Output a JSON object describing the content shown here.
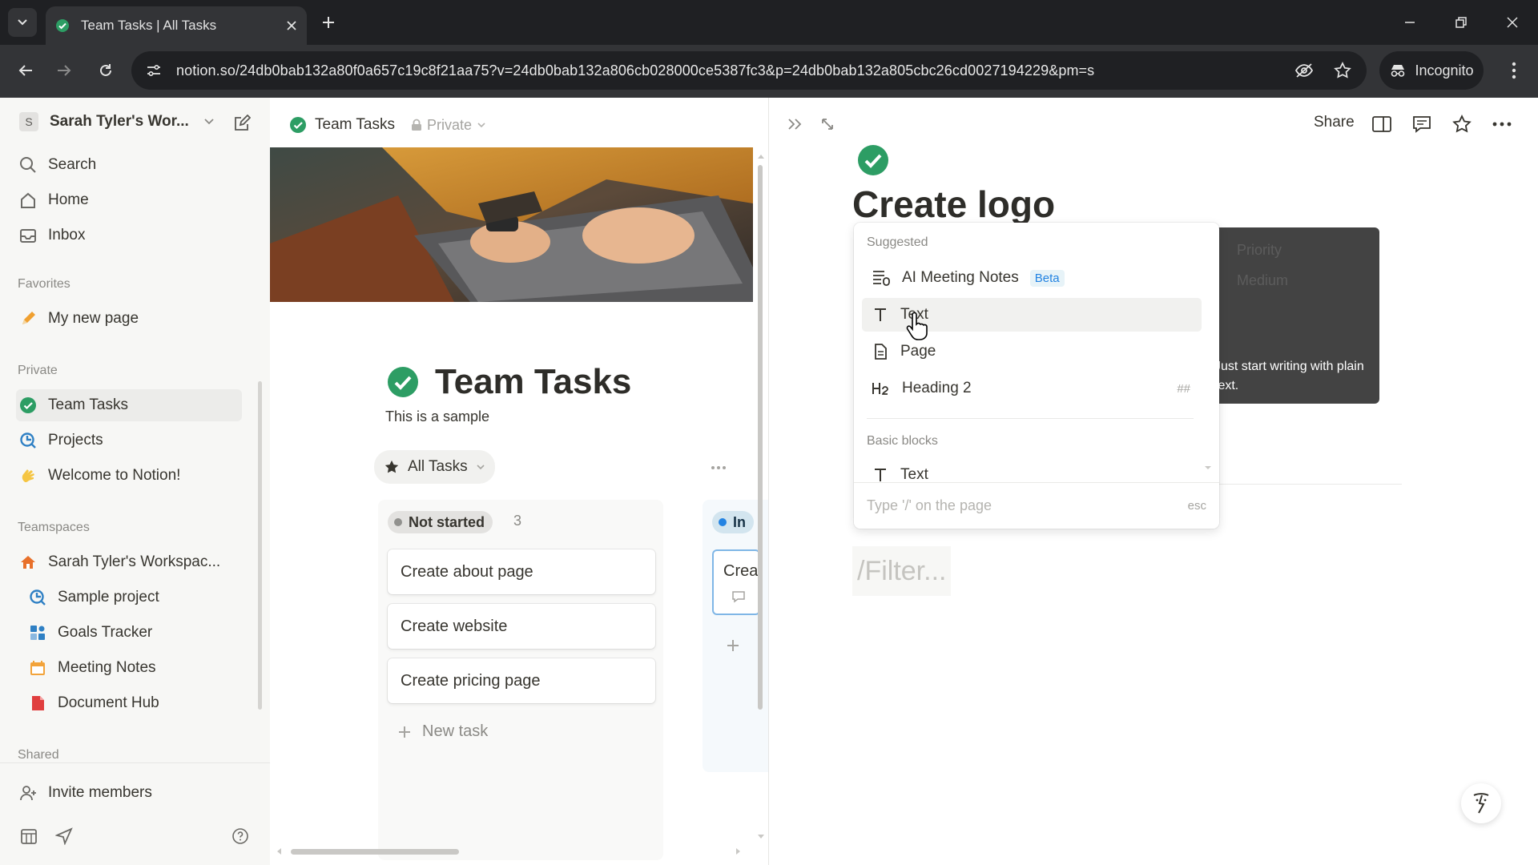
{
  "browser": {
    "tab_title": "Team Tasks | All Tasks",
    "url": "notion.so/24db0bab132a80f0a657c19c8f21aa75?v=24db0bab132a806cb028000ce5387fc3&p=24db0bab132a805cbc26cd0027194229&pm=s",
    "incognito_label": "Incognito"
  },
  "sidebar": {
    "workspace_initial": "S",
    "workspace_name": "Sarah Tyler's Wor...",
    "nav": [
      {
        "label": "Search",
        "icon": "search-icon"
      },
      {
        "label": "Home",
        "icon": "home-icon"
      },
      {
        "label": "Inbox",
        "icon": "inbox-icon"
      }
    ],
    "favorites_label": "Favorites",
    "favorites": [
      {
        "label": "My new page",
        "icon": "pencil-icon"
      }
    ],
    "private_label": "Private",
    "private": [
      {
        "label": "Team Tasks",
        "icon": "check-circle-icon"
      },
      {
        "label": "Projects",
        "icon": "projects-icon"
      },
      {
        "label": "Welcome to Notion!",
        "icon": "wave-icon"
      }
    ],
    "teamspaces_label": "Teamspaces",
    "teamspace_name": "Sarah Tyler's Workspac...",
    "teamspace_items": [
      {
        "label": "Sample project",
        "icon": "projects-icon"
      },
      {
        "label": "Goals Tracker",
        "icon": "goals-icon"
      },
      {
        "label": "Meeting Notes",
        "icon": "calendar-icon"
      },
      {
        "label": "Document Hub",
        "icon": "document-icon"
      }
    ],
    "shared_label": "Shared",
    "invite_label": "Invite members"
  },
  "middle": {
    "breadcrumb_title": "Team Tasks",
    "privacy_label": "Private",
    "page_title": "Team Tasks",
    "page_description": "This is a sample",
    "view_label": "All Tasks",
    "group_label": "Not started",
    "group_count": "3",
    "group2_label": "In",
    "cards": [
      "Create about page",
      "Create website",
      "Create pricing page"
    ],
    "partial_card": "Crea",
    "new_task_label": "New task"
  },
  "right": {
    "share_label": "Share",
    "page_title": "Create logo",
    "filter_text": "/Filter..."
  },
  "slash_menu": {
    "suggested_label": "Suggested",
    "items": [
      {
        "label": "AI Meeting Notes",
        "badge": "Beta",
        "icon": "meeting-notes-icon"
      },
      {
        "label": "Text",
        "icon": "text-icon"
      },
      {
        "label": "Page",
        "icon": "page-icon"
      },
      {
        "label": "Heading 2",
        "shortcut": "##",
        "icon": "heading2-icon"
      }
    ],
    "basic_label": "Basic blocks",
    "basic_items": [
      {
        "label": "Text",
        "icon": "text-icon"
      }
    ],
    "footer_hint": "Type '/' on the page",
    "footer_esc": "esc"
  },
  "tooltip": {
    "ghost_property": "Priority",
    "ghost_value": "Medium",
    "text": "Just start writing with plain text."
  },
  "colors": {
    "accent_green": "#2d9d64",
    "blue_badge": "#2383e2"
  }
}
